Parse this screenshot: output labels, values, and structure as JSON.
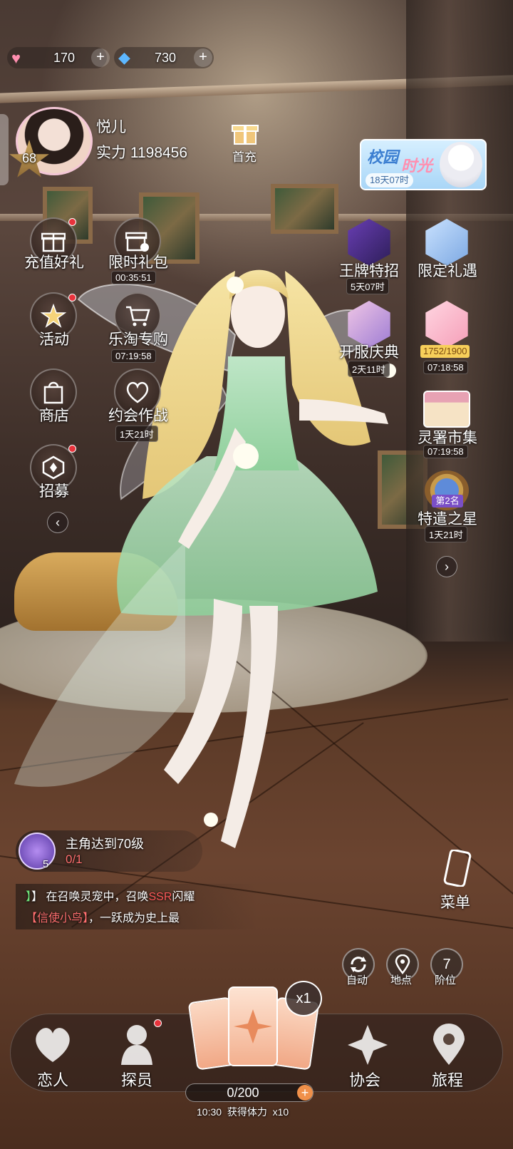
{
  "currency": {
    "hearts": "170",
    "diamonds": "730"
  },
  "player": {
    "name": "悦儿",
    "power_label": "实力 1198456",
    "level": "68"
  },
  "first_recharge": "首充",
  "left_menu": [
    {
      "label": "充值好礼"
    },
    {
      "label": "限时礼包",
      "timer": "00:35:51"
    },
    {
      "label": "活动"
    },
    {
      "label": "乐淘专购",
      "timer": "07:19:58"
    },
    {
      "label": "商店"
    },
    {
      "label": "约会作战",
      "timer": "1天21时"
    },
    {
      "label": "招募"
    }
  ],
  "campus_banner": {
    "title_a": "校园",
    "title_b": "时光",
    "timer": "18天07时"
  },
  "right_menu": [
    {
      "label": "王牌特招",
      "timer": "5天07时"
    },
    {
      "label": "限定礼遇"
    },
    {
      "label": "开服庆典",
      "timer": "2天11时"
    },
    {
      "label": "1752/1900",
      "timer": "07:18:58"
    },
    {
      "label": "灵署市集",
      "timer": "07:19:58"
    },
    {
      "label": "特遣之星",
      "rank": "第2名",
      "timer": "1天21时"
    }
  ],
  "quest": {
    "title": "主角达到70级",
    "progress": "0/1",
    "badge": "5"
  },
  "chat": {
    "line1_prefix": "】 在召唤灵宠中，召唤",
    "line1_ssr": "SSR",
    "line1_suffix": "闪耀",
    "line2_name": "【信使小鸟】",
    "line2_rest": "，一跃成为史上最"
  },
  "menu_label": "菜单",
  "quick_buttons": [
    {
      "label": "自动"
    },
    {
      "label": "地点"
    },
    {
      "label": "阶位",
      "value": "7"
    }
  ],
  "cards_multiplier": "x1",
  "bottom_nav": [
    {
      "label": "恋人"
    },
    {
      "label": "探员"
    },
    {
      "label": "协会"
    },
    {
      "label": "旅程"
    }
  ],
  "stamina": {
    "value": "0/200",
    "note": "10:30  获得体力  x10"
  },
  "colors": {
    "accent_red": "#e8333c",
    "ssr_color": "#ff5a5a",
    "name_color": "#ff6f6f",
    "chat_bracket": "#6fe37a",
    "gold": "#f5c85a"
  }
}
